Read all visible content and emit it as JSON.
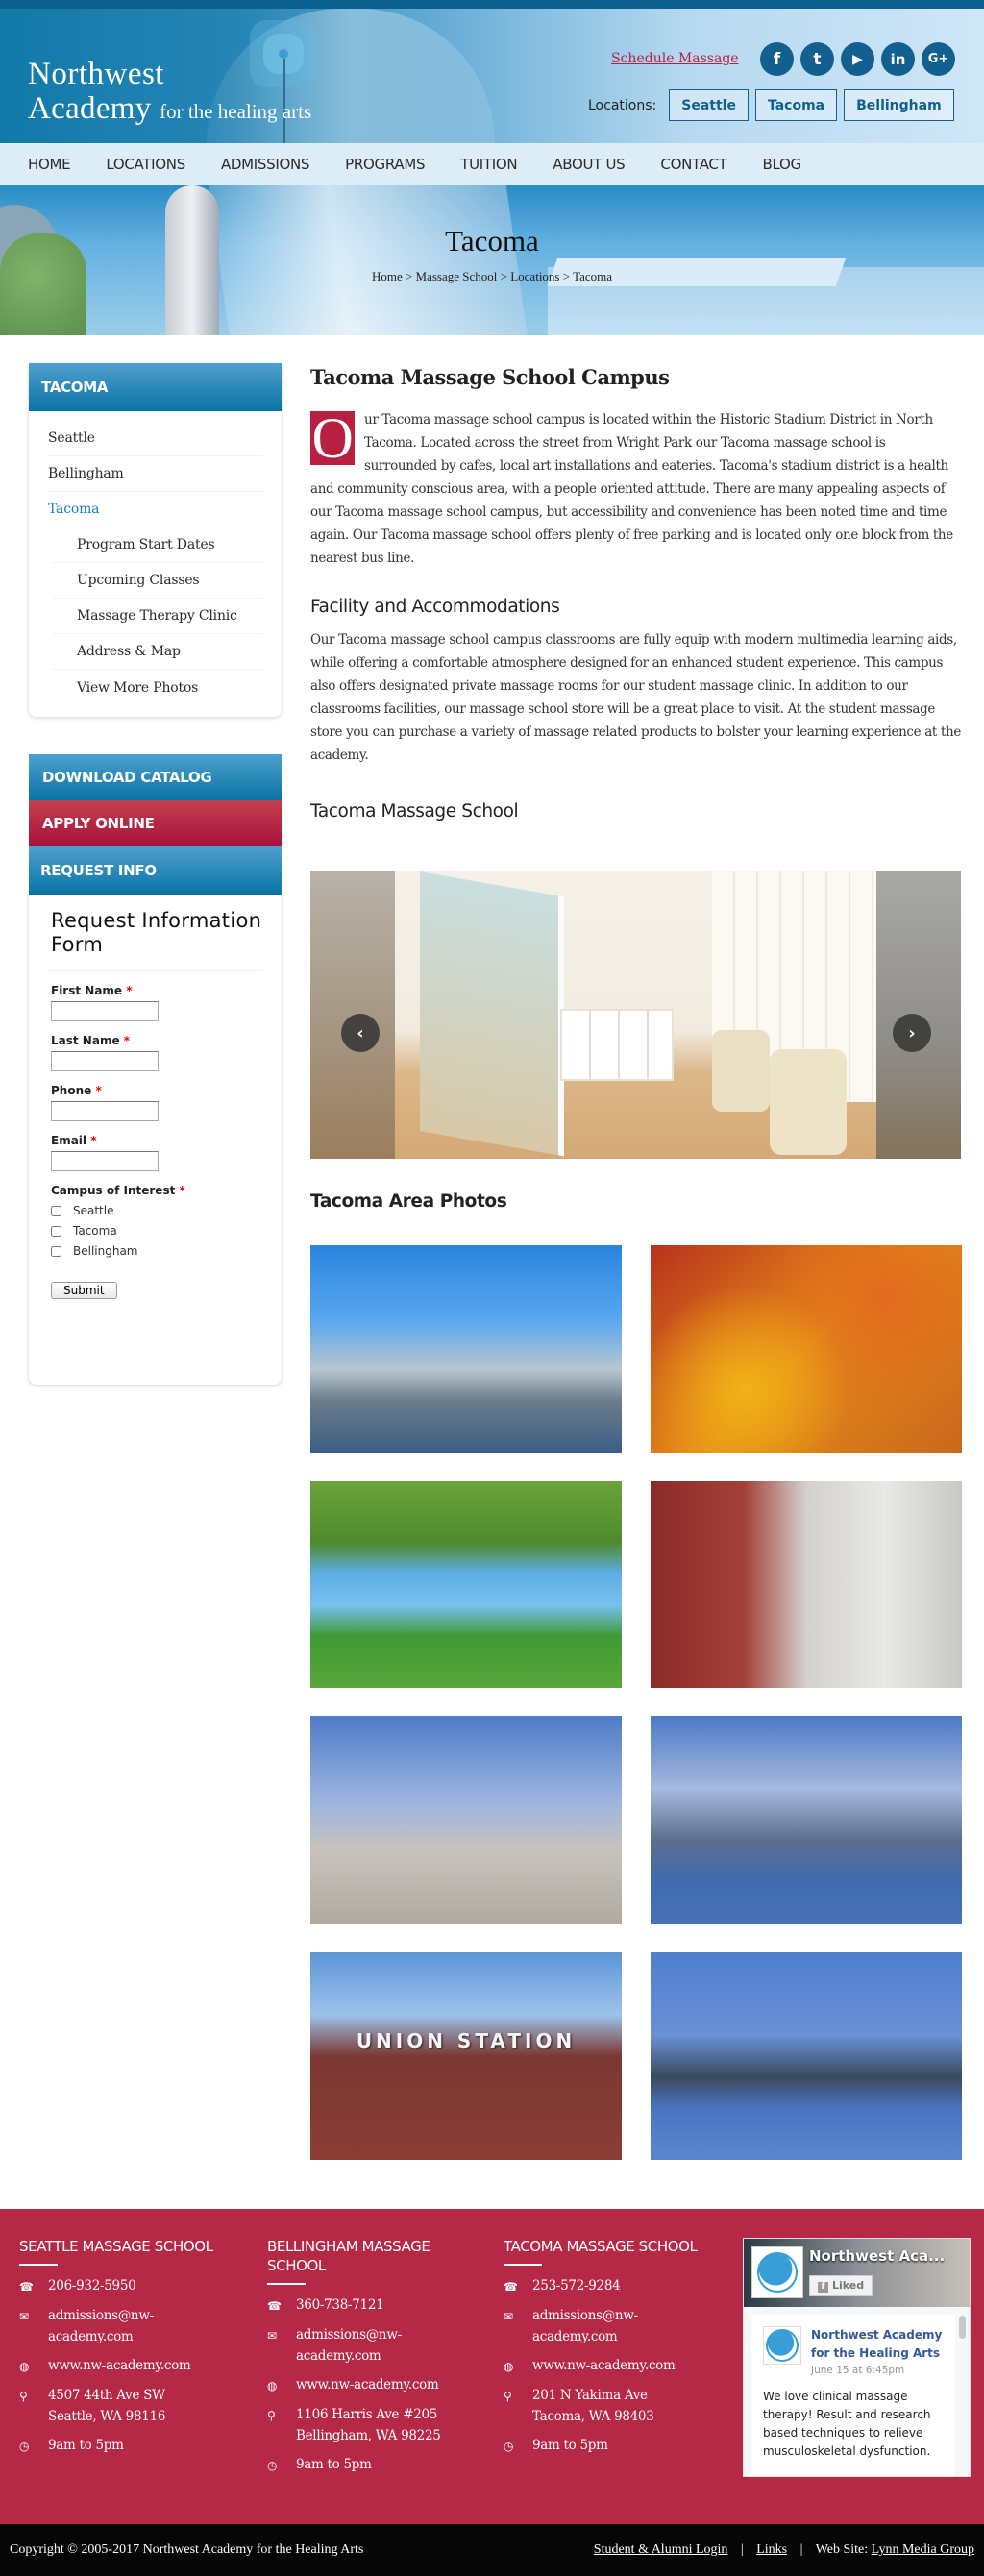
{
  "header": {
    "logo_line1": "Northwest",
    "logo_line2": "Academy",
    "logo_tagline": "for the healing arts",
    "schedule_link": "Schedule Massage",
    "social": [
      {
        "name": "facebook-icon",
        "glyph": "f"
      },
      {
        "name": "twitter-icon",
        "glyph": "t"
      },
      {
        "name": "youtube-icon",
        "glyph": "▶"
      },
      {
        "name": "linkedin-icon",
        "glyph": "in"
      },
      {
        "name": "google-plus-icon",
        "glyph": "G+"
      }
    ],
    "locations_label": "Locations:",
    "locations": [
      "Seattle",
      "Tacoma",
      "Bellingham"
    ]
  },
  "nav": [
    "HOME",
    "LOCATIONS",
    "ADMISSIONS",
    "PROGRAMS",
    "TUITION",
    "ABOUT US",
    "CONTACT",
    "BLOG"
  ],
  "hero": {
    "title": "Tacoma",
    "breadcrumb": "Home > Massage School > Locations > Tacoma"
  },
  "sidebar": {
    "heading": "TACOMA",
    "items": [
      {
        "label": "Seattle",
        "type": "top"
      },
      {
        "label": "Bellingham",
        "type": "top"
      },
      {
        "label": "Tacoma",
        "type": "active"
      },
      {
        "label": "Program Start Dates",
        "type": "sub"
      },
      {
        "label": "Upcoming Classes",
        "type": "sub"
      },
      {
        "label": "Massage Therapy Clinic",
        "type": "sub"
      },
      {
        "label": "Address & Map",
        "type": "sub"
      },
      {
        "label": "View More Photos",
        "type": "sub"
      }
    ],
    "download_catalog": "DOWNLOAD CATALOG",
    "apply_online": "APPLY ONLINE",
    "request_info": "REQUEST INFO"
  },
  "form": {
    "title": "Request Information Form",
    "fields": [
      {
        "label": "First Name",
        "value": ""
      },
      {
        "label": "Last Name",
        "value": ""
      },
      {
        "label": "Phone",
        "value": ""
      },
      {
        "label": "Email",
        "value": ""
      }
    ],
    "required_mark": "*",
    "campus_label": "Campus of Interest",
    "campus_options": [
      {
        "label": "Seattle",
        "checked": false
      },
      {
        "label": "Tacoma",
        "checked": false
      },
      {
        "label": "Bellingham",
        "checked": false
      }
    ],
    "submit": "Submit"
  },
  "main": {
    "title": "Tacoma Massage School Campus",
    "dropcap": "O",
    "intro": "ur Tacoma massage school campus is located within the Historic Stadium District in North Tacoma. Located across the street from Wright Park our Tacoma massage school is surrounded by cafes, local art installations and eateries. Tacoma's stadium district is a health and community conscious area, with a people oriented attitude. There are many appealing aspects of our Tacoma massage school campus, but accessibility and convenience has been noted time and time again. Our Tacoma massage school offers plenty of free parking and is located only one block from the nearest bus line.",
    "facility_heading": "Facility and Accommodations",
    "facility_text": "Our Tacoma massage school campus classrooms are fully equip with modern multimedia learning aids, while offering a comfortable atmosphere designed for an enhanced student experience. This campus also offers designated private massage rooms for our student massage clinic. In addition to our classrooms facilities, our massage school store will be a great place to visit. At the student massage store you can purchase a variety of massage related products to bolster your learning experience at the academy.",
    "school_heading": "Tacoma Massage School",
    "slider": {
      "prev": "‹",
      "next": "›"
    },
    "area_heading": "Tacoma Area Photos",
    "photos": [
      {
        "name": "photo-museum-of-glass-kayak",
        "caption": ""
      },
      {
        "name": "photo-chihuly-glass",
        "caption": ""
      },
      {
        "name": "photo-park-mount-rainier",
        "caption": ""
      },
      {
        "name": "photo-old-city-hall-street",
        "caption": ""
      },
      {
        "name": "photo-glass-columns-plaza",
        "caption": ""
      },
      {
        "name": "photo-marina-bridge",
        "caption": ""
      },
      {
        "name": "photo-union-station",
        "caption": "UNION STATION"
      },
      {
        "name": "photo-tacoma-dome-night",
        "caption": ""
      }
    ]
  },
  "footer": {
    "columns": [
      {
        "heading": "SEATTLE MASSAGE SCHOOL",
        "phone": "206-932-5950",
        "email": "admissions@nw-academy.com",
        "web": "www.nw-academy.com",
        "address1": "4507 44th Ave SW",
        "address2": "Seattle, WA 98116",
        "hours": "9am to 5pm"
      },
      {
        "heading": "BELLINGHAM MASSAGE SCHOOL",
        "phone": "360-738-7121",
        "email": "admissions@nw-academy.com",
        "web": "www.nw-academy.com",
        "address1": "1106 Harris Ave #205",
        "address2": "Bellingham, WA 98225",
        "hours": "9am to 5pm"
      },
      {
        "heading": "TACOMA MASSAGE SCHOOL",
        "phone": "253-572-9284",
        "email": "admissions@nw-academy.com",
        "web": "www.nw-academy.com",
        "address1": "201 N Yakima Ave",
        "address2": "Tacoma, WA 98403",
        "hours": "9am to 5pm"
      }
    ],
    "facebook": {
      "page_name": "Northwest Aca...",
      "liked": "Liked",
      "post_author": "Northwest Academy for the Healing Arts",
      "post_date": "June 15 at 6:45pm",
      "post_text": "We love clinical massage therapy! Result and research based techniques to relieve musculoskeletal dysfunction."
    },
    "copyright": "Copyright © 2005-2017 Northwest Academy for the Healing Arts",
    "links": {
      "login": "Student & Alumni Login",
      "links": "Links",
      "web_label": "Web Site: ",
      "web_link": "Lynn Media Group",
      "separator": "|"
    }
  },
  "colors": {
    "brand_blue": "#0a73a5",
    "brand_red": "#b52946",
    "link_red": "#b3213f",
    "active_blue": "#1b7fb4"
  }
}
